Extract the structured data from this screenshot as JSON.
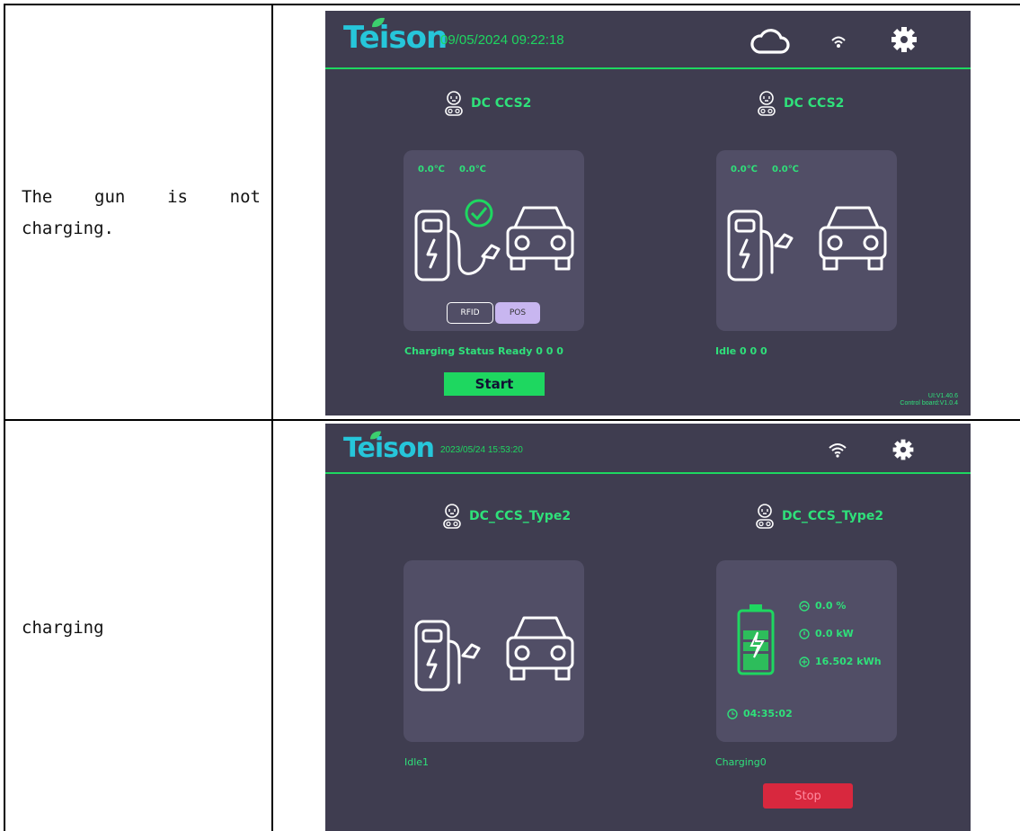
{
  "rows": [
    {
      "description": [
        "The gun is not",
        "charging."
      ],
      "screen": {
        "brand": "Teison",
        "datetime": "09/05/2024 09:22:18",
        "guns": [
          {
            "name": "DC CCS2",
            "temp1": "0.0℃",
            "temp2": "0.0℃",
            "payment_buttons": [
              "RFID",
              "POS"
            ],
            "status": "Charging Status Ready 0 0 0",
            "action_label": "Start"
          },
          {
            "name": "DC CCS2",
            "temp1": "0.0℃",
            "temp2": "0.0℃",
            "status": "Idle 0 0 0"
          }
        ],
        "version_ui": "UI:V1.40.6",
        "version_board": "Control board:V1.0.4"
      }
    },
    {
      "description": [
        "charging"
      ],
      "screen": {
        "brand": "Teison",
        "datetime": "2023/05/24 15:53:20",
        "guns": [
          {
            "name": "DC_CCS_Type2",
            "status": "Idle1"
          },
          {
            "name": "DC_CCS_Type2",
            "soc": "0.0 %",
            "power": "0.0 kW",
            "energy": "16.502 kWh",
            "duration": "04:35:02",
            "status": "Charging0",
            "action_label": "Stop"
          }
        ]
      }
    }
  ],
  "icons": [
    "cloud-icon",
    "wifi-icon",
    "gear-icon",
    "connector-icon",
    "charger-station-icon",
    "car-icon",
    "check-circle-icon",
    "battery-icon",
    "speedometer-icon",
    "power-icon",
    "energy-icon",
    "clock-icon"
  ],
  "colors": {
    "screen_bg": "#3f3d50",
    "panel_bg": "#514e66",
    "accent_green": "#1ed760",
    "start_button": "#1ed760",
    "stop_button": "#d8283e",
    "pos_button": "#c8b6f0"
  }
}
